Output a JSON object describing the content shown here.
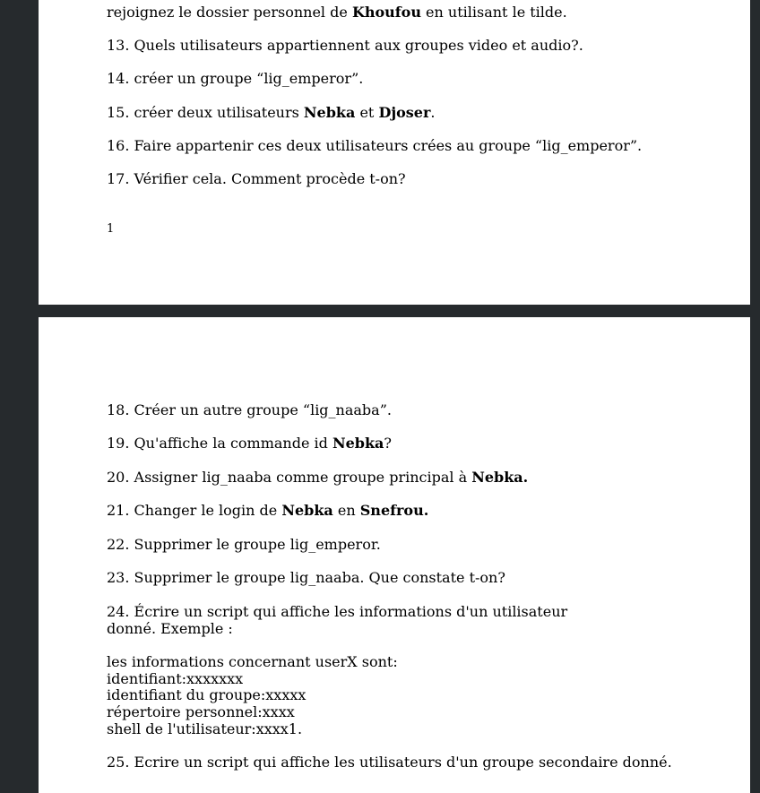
{
  "page1": {
    "top_fragment": "rejoignez le dossier personnel de ",
    "top_fragment_bold": "Khoufou",
    "top_fragment_end": " en utilisant le tilde.",
    "q13": "13. Quels utilisateurs appartiennent aux groupes video et audio?.",
    "q14": "14. créer un groupe “lig_emperor”.",
    "q15_a": "15. créer deux utilisateurs ",
    "q15_b": "Nebka",
    "q15_c": " et ",
    "q15_d": "Djoser",
    "q15_e": ".",
    "q16": "16. Faire appartenir ces deux utilisateurs crées au groupe “lig_emperor”.",
    "q17": "17. Vérifier cela. Comment procède t-on?",
    "page_number": "1"
  },
  "page2": {
    "q18": "18. Créer un autre groupe “lig_naaba”.",
    "q19_a": "19. Qu'affiche la commande id ",
    "q19_b": "Nebka",
    "q19_c": "?",
    "q20_a": "20. Assigner lig_naaba comme groupe principal à ",
    "q20_b": "Nebka.",
    "q21_a": "21. Changer le login de ",
    "q21_b": "Nebka",
    "q21_c": " en ",
    "q21_d": "Snefrou.",
    "q22": "22. Supprimer le groupe lig_emperor.",
    "q23": "23. Supprimer le groupe lig_naaba. Que constate t-on?",
    "q24_l1": "24. Écrire un script qui affiche les informations d'un utilisateur",
    "q24_l2": "donné. Exemple :",
    "ex_l1": "les informations concernant userX sont:",
    "ex_l2": "identifiant:xxxxxxx",
    "ex_l3": "identifiant du groupe:xxxxx",
    "ex_l4": "répertoire personnel:xxxx",
    "ex_l5": "shell de l'utilisateur:xxxx1.",
    "q25": "25. Ecrire un script qui affiche les utilisateurs d'un groupe secondaire donné."
  }
}
